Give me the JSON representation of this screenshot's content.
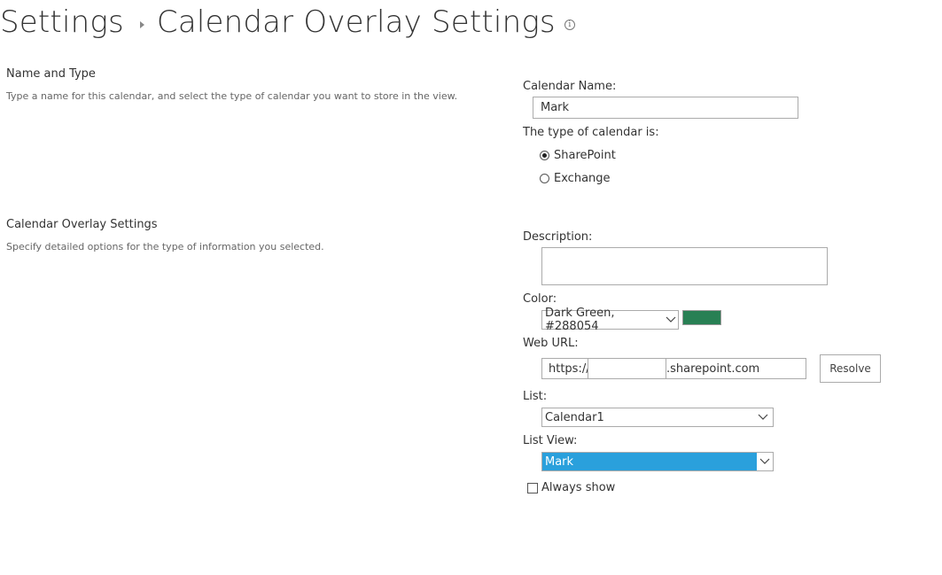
{
  "header": {
    "breadcrumb_root": "Settings",
    "page_title": "Calendar Overlay Settings"
  },
  "sections": {
    "name_type": {
      "title": "Name and Type",
      "description": "Type a name for this calendar, and select the type of calendar you want to store in the view."
    },
    "overlay": {
      "title": "Calendar Overlay Settings",
      "description": "Specify detailed options for the type of information you selected."
    }
  },
  "form": {
    "calendar_name_label": "Calendar Name:",
    "calendar_name_value": "Mark",
    "calendar_type_label": "The type of calendar is:",
    "calendar_types": [
      {
        "label": "SharePoint",
        "checked": true
      },
      {
        "label": "Exchange",
        "checked": false
      }
    ],
    "description_label": "Description:",
    "description_value": "",
    "color_label": "Color:",
    "color_selected": "Dark Green, #288054",
    "color_swatch": "#288054",
    "web_url_label": "Web URL:",
    "web_url_prefix": "https://",
    "web_url_suffix": ".sharepoint.com",
    "resolve_label": "Resolve",
    "list_label": "List:",
    "list_selected": "Calendar1",
    "list_view_label": "List View:",
    "list_view_selected": "Mark",
    "always_show_label": "Always show",
    "always_show_checked": false
  },
  "icons": {
    "info": "info-icon",
    "breadcrumb_separator": "triangle-right-icon",
    "dropdown": "chevron-down-icon"
  }
}
